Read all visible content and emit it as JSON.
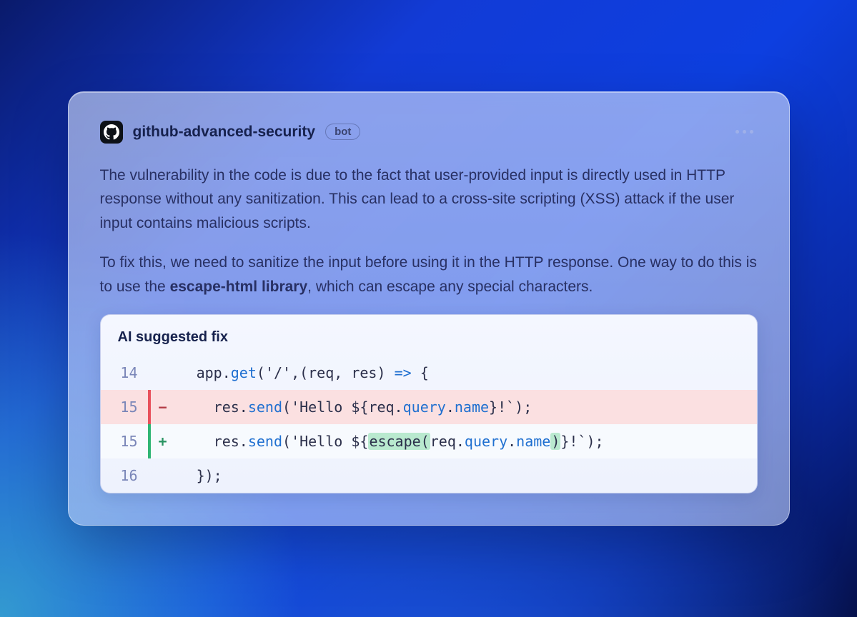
{
  "header": {
    "username": "github-advanced-security",
    "bot_label": "bot"
  },
  "body": {
    "para1": "The vulnerability in the code is due to the fact that user-provided input is directly used in HTTP response without any sanitization. This can lead to a cross-site scripting (XSS) attack if the user input contains malicious scripts.",
    "para2_pre": "To fix this, we need to sanitize the input before using it in the HTTP response. One way to do this is to use the ",
    "para2_strong": "escape-html library",
    "para2_post": ", which can escape any special characters."
  },
  "code": {
    "title": "AI suggested fix",
    "lines": {
      "l14": {
        "num": "14",
        "indent": "  ",
        "t1": "app.",
        "fn": "get",
        "t2": "(",
        "str": "'/'",
        "t3": ",(req, res) ",
        "op": "=>",
        "t4": " {"
      },
      "l15del": {
        "num": "15",
        "sign": "−",
        "indent": "    ",
        "t1": "res.",
        "fn": "send",
        "t2": "(",
        "str1": "'Hello ${",
        "t3": "req.",
        "p1": "query",
        "t4": ".",
        "p2": "name",
        "str2": "}!`",
        "t5": ");"
      },
      "l15add": {
        "num": "15",
        "sign": "+",
        "indent": "    ",
        "t1": "res.",
        "fn": "send",
        "t2": "(",
        "str1": "'Hello ${",
        "hl1": "escape(",
        "t3": "req.",
        "p1": "query",
        "t4": ".",
        "p2": "name",
        "hl2": ")",
        "str2": "}!`",
        "t5": ");"
      },
      "l16": {
        "num": "16",
        "indent": "  ",
        "t1": "});"
      }
    }
  }
}
